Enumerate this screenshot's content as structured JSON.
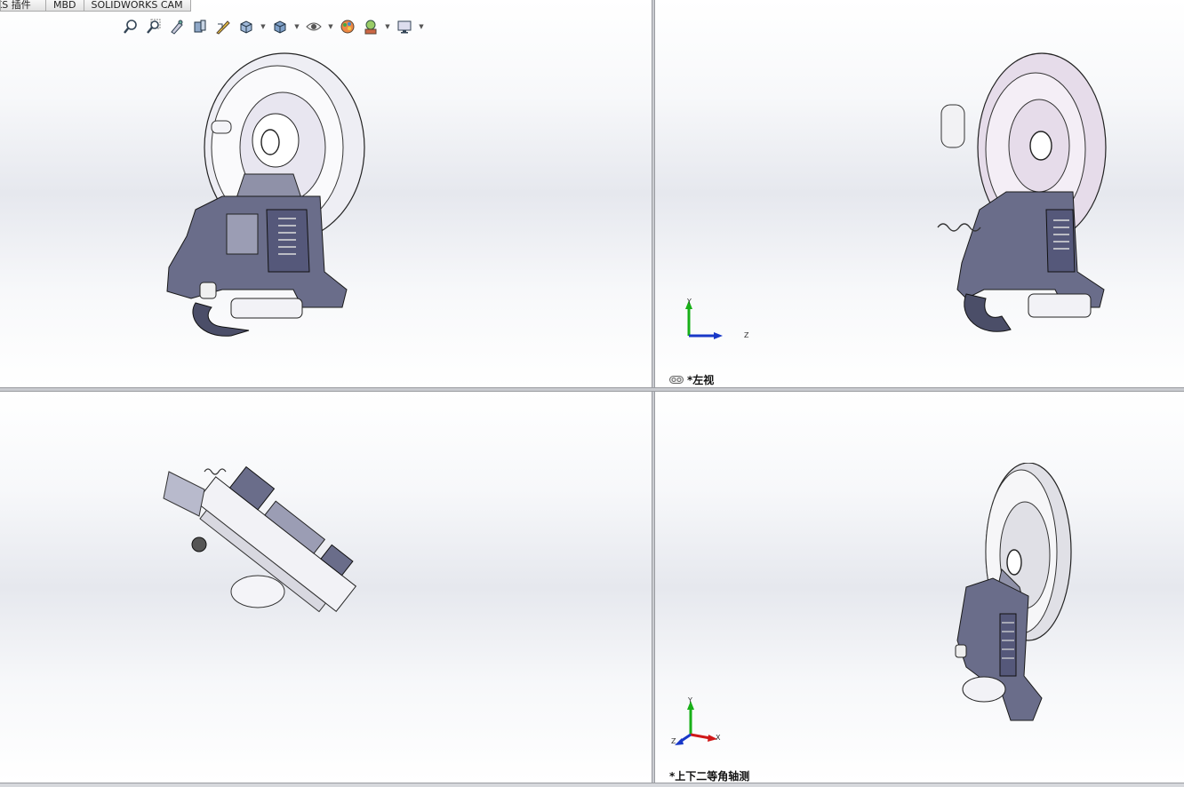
{
  "tabs": [
    "KS 插件",
    "MBD",
    "SOLIDWORKS CAM"
  ],
  "toolbar": {
    "icons": [
      "zoom-to-fit-icon",
      "zoom-to-area-icon",
      "previous-view-icon",
      "section-view-icon",
      "dynamic-annotation-icon",
      "view-orientation-icon",
      "display-style-icon",
      "hide-show-items-icon",
      "edit-appearance-icon",
      "apply-scene-icon",
      "view-settings-icon"
    ]
  },
  "viewports": {
    "top_right": {
      "label": "*左视"
    },
    "bottom_right": {
      "label": "*上下二等角轴测"
    }
  },
  "triads": {
    "left": {
      "y": "Y",
      "z": "Z"
    },
    "iso": {
      "y": "Y",
      "x": "X",
      "z": "Z"
    }
  },
  "colors": {
    "part_dark": "#5f6280",
    "part_light": "#d4d6e4",
    "pulley": "#eeeef4",
    "axis_x": "#d01818",
    "axis_y": "#18b018",
    "axis_z": "#1838c8"
  }
}
